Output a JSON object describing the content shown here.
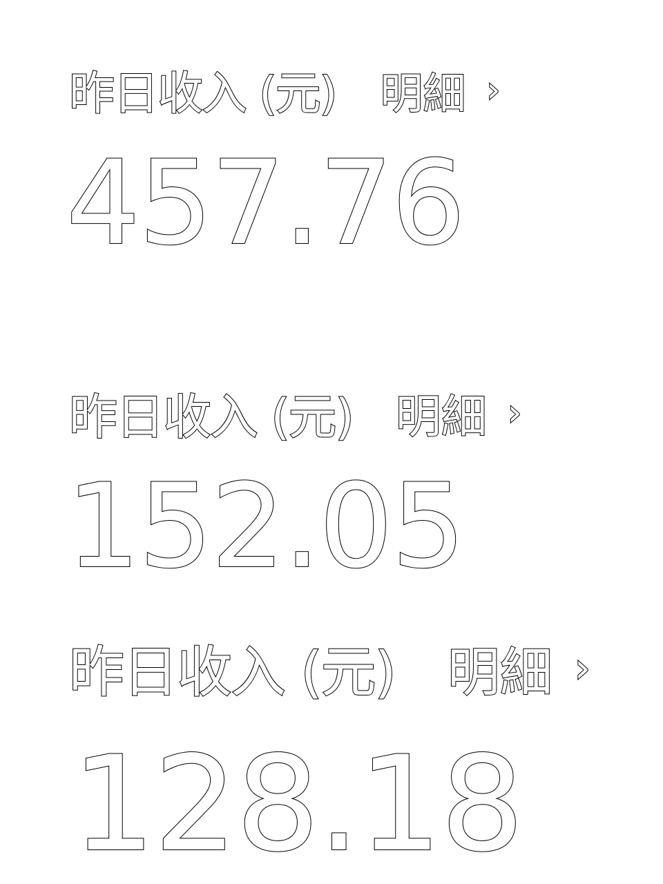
{
  "cards": [
    {
      "label": "昨日收入 (元)",
      "detail_label": "明細",
      "chevron": "›",
      "amount": "457.76"
    },
    {
      "label": "昨日收入 (元)",
      "detail_label": "明細",
      "chevron": "›",
      "amount": "152.05"
    },
    {
      "label": "昨日收入 (元)",
      "detail_label": "明細",
      "chevron": "›",
      "amount": "128.18"
    }
  ],
  "colors": {
    "background": "#ffffff",
    "text_outline": "#000000"
  },
  "icons": {
    "detail_chevron": "chevron-right-icon"
  }
}
